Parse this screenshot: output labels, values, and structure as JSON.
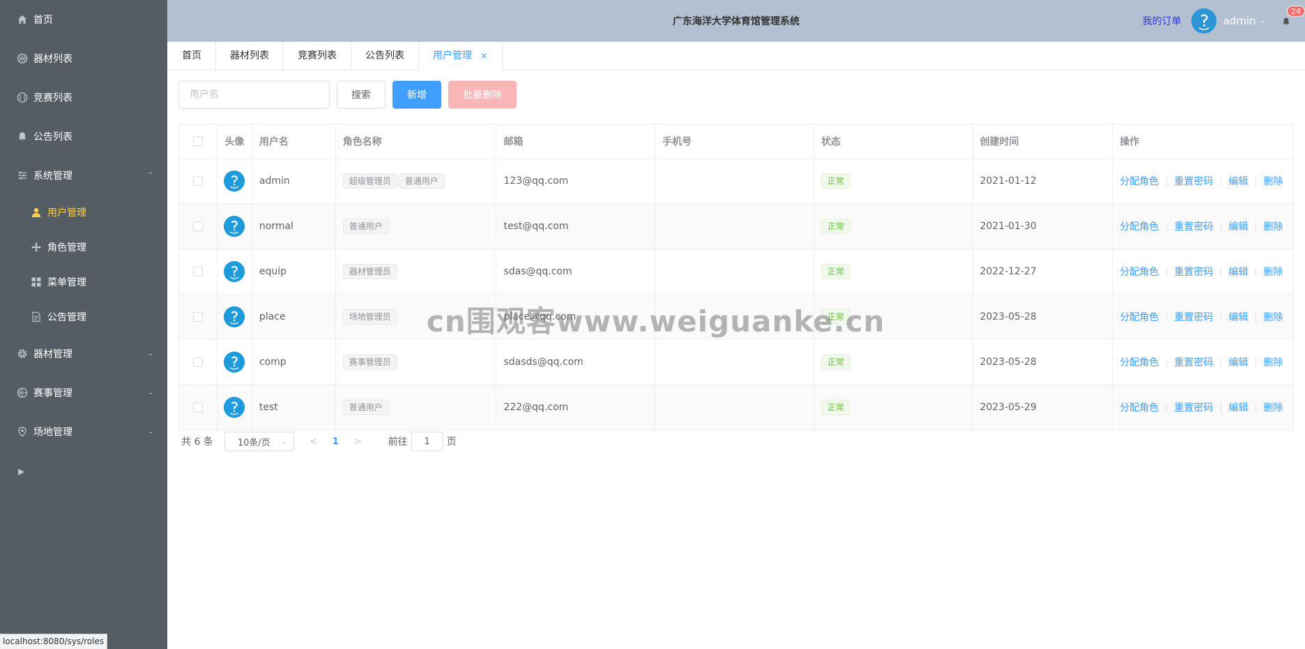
{
  "sidebar": {
    "items": [
      {
        "label": "首页",
        "icon": "home-icon"
      },
      {
        "label": "器材列表",
        "icon": "basketball-icon"
      },
      {
        "label": "竞赛列表",
        "icon": "baseball-icon"
      },
      {
        "label": "公告列表",
        "icon": "bell-icon"
      },
      {
        "label": "系统管理",
        "icon": "sliders-icon",
        "expanded": true
      }
    ],
    "sub_items": [
      {
        "label": "用户管理",
        "icon": "user-icon",
        "active": true
      },
      {
        "label": "角色管理",
        "icon": "rank-icon"
      },
      {
        "label": "菜单管理",
        "icon": "menu-grid-icon"
      },
      {
        "label": "公告管理",
        "icon": "document-icon"
      }
    ],
    "bottom_items": [
      {
        "label": "器材管理",
        "icon": "setting-icon"
      },
      {
        "label": "赛事管理",
        "icon": "basketball-icon"
      },
      {
        "label": "场地管理",
        "icon": "location-icon"
      }
    ],
    "active_color": "#ffd04b",
    "bg_color": "#545c64"
  },
  "header": {
    "title": "广东海洋大学体育馆管理系统",
    "my_orders": "我的订单",
    "username": "admin",
    "notification_count": "24"
  },
  "tabs": [
    {
      "label": "首页"
    },
    {
      "label": "器材列表"
    },
    {
      "label": "竞赛列表"
    },
    {
      "label": "公告列表"
    },
    {
      "label": "用户管理",
      "active": true,
      "close": "×"
    }
  ],
  "toolbar": {
    "search_placeholder": "用户名",
    "search_label": "搜索",
    "add_label": "新增",
    "batch_delete_label": "批量删除"
  },
  "table": {
    "columns": [
      "头像",
      "用户名",
      "角色名称",
      "邮箱",
      "手机号",
      "状态",
      "创建时间",
      "操作"
    ],
    "rows": [
      {
        "username": "admin",
        "roles": [
          "超级管理员",
          "普通用户"
        ],
        "email": "123@qq.com",
        "phone": "",
        "status": "正常",
        "created": "2021-01-12"
      },
      {
        "username": "normal",
        "roles": [
          "普通用户"
        ],
        "email": "test@qq.com",
        "phone": "",
        "status": "正常",
        "created": "2021-01-30"
      },
      {
        "username": "equip",
        "roles": [
          "器材管理员"
        ],
        "email": "sdas@qq.com",
        "phone": "",
        "status": "正常",
        "created": "2022-12-27"
      },
      {
        "username": "place",
        "roles": [
          "场地管理员"
        ],
        "email": "place@qq.com",
        "phone": "",
        "status": "正常",
        "created": "2023-05-28"
      },
      {
        "username": "comp",
        "roles": [
          "赛事管理员"
        ],
        "email": "sdasds@qq.com",
        "phone": "",
        "status": "正常",
        "created": "2023-05-28"
      },
      {
        "username": "test",
        "roles": [
          "普通用户"
        ],
        "email": "222@qq.com",
        "phone": "",
        "status": "正常",
        "created": "2023-05-29"
      }
    ],
    "actions": [
      "分配角色",
      "重置密码",
      "编辑",
      "删除"
    ]
  },
  "pagination": {
    "total": "共 6 条",
    "page_size": "10条/页",
    "current_page": "1",
    "goto_prefix": "前往",
    "goto_value": "1",
    "goto_suffix": "页"
  },
  "watermark": "cn围观客www.weiguanke.cn",
  "status_url": "localhost:8080/sys/roles",
  "colors": {
    "primary": "#409eff",
    "header_bg": "#b3c0d1",
    "success": "#67c23a"
  }
}
